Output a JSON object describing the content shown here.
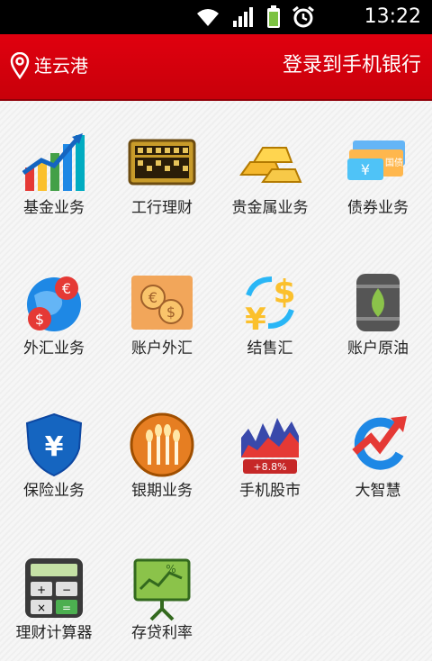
{
  "status_bar": {
    "time": "13:22"
  },
  "header": {
    "location": "连云港",
    "login": "登录到手机银行"
  },
  "tiles": [
    {
      "label": "基金业务",
      "icon": "fund-chart-icon"
    },
    {
      "label": "工行理财",
      "icon": "abacus-icon"
    },
    {
      "label": "贵金属业务",
      "icon": "gold-bars-icon"
    },
    {
      "label": "债券业务",
      "icon": "bond-cards-icon"
    },
    {
      "label": "外汇业务",
      "icon": "globe-currency-icon"
    },
    {
      "label": "账户外汇",
      "icon": "currency-coins-icon"
    },
    {
      "label": "结售汇",
      "icon": "currency-exchange-icon"
    },
    {
      "label": "账户原油",
      "icon": "oil-barrel-icon"
    },
    {
      "label": "保险业务",
      "icon": "shield-yen-icon"
    },
    {
      "label": "银期业务",
      "icon": "wheat-coin-icon"
    },
    {
      "label": "手机股市",
      "icon": "stock-chart-icon"
    },
    {
      "label": "大智慧",
      "icon": "dazhihui-logo-icon"
    },
    {
      "label": "理财计算器",
      "icon": "calculator-icon"
    },
    {
      "label": "存贷利率",
      "icon": "rate-board-icon"
    }
  ],
  "stock_badge": "+8.8%",
  "bond_badge": "国债"
}
